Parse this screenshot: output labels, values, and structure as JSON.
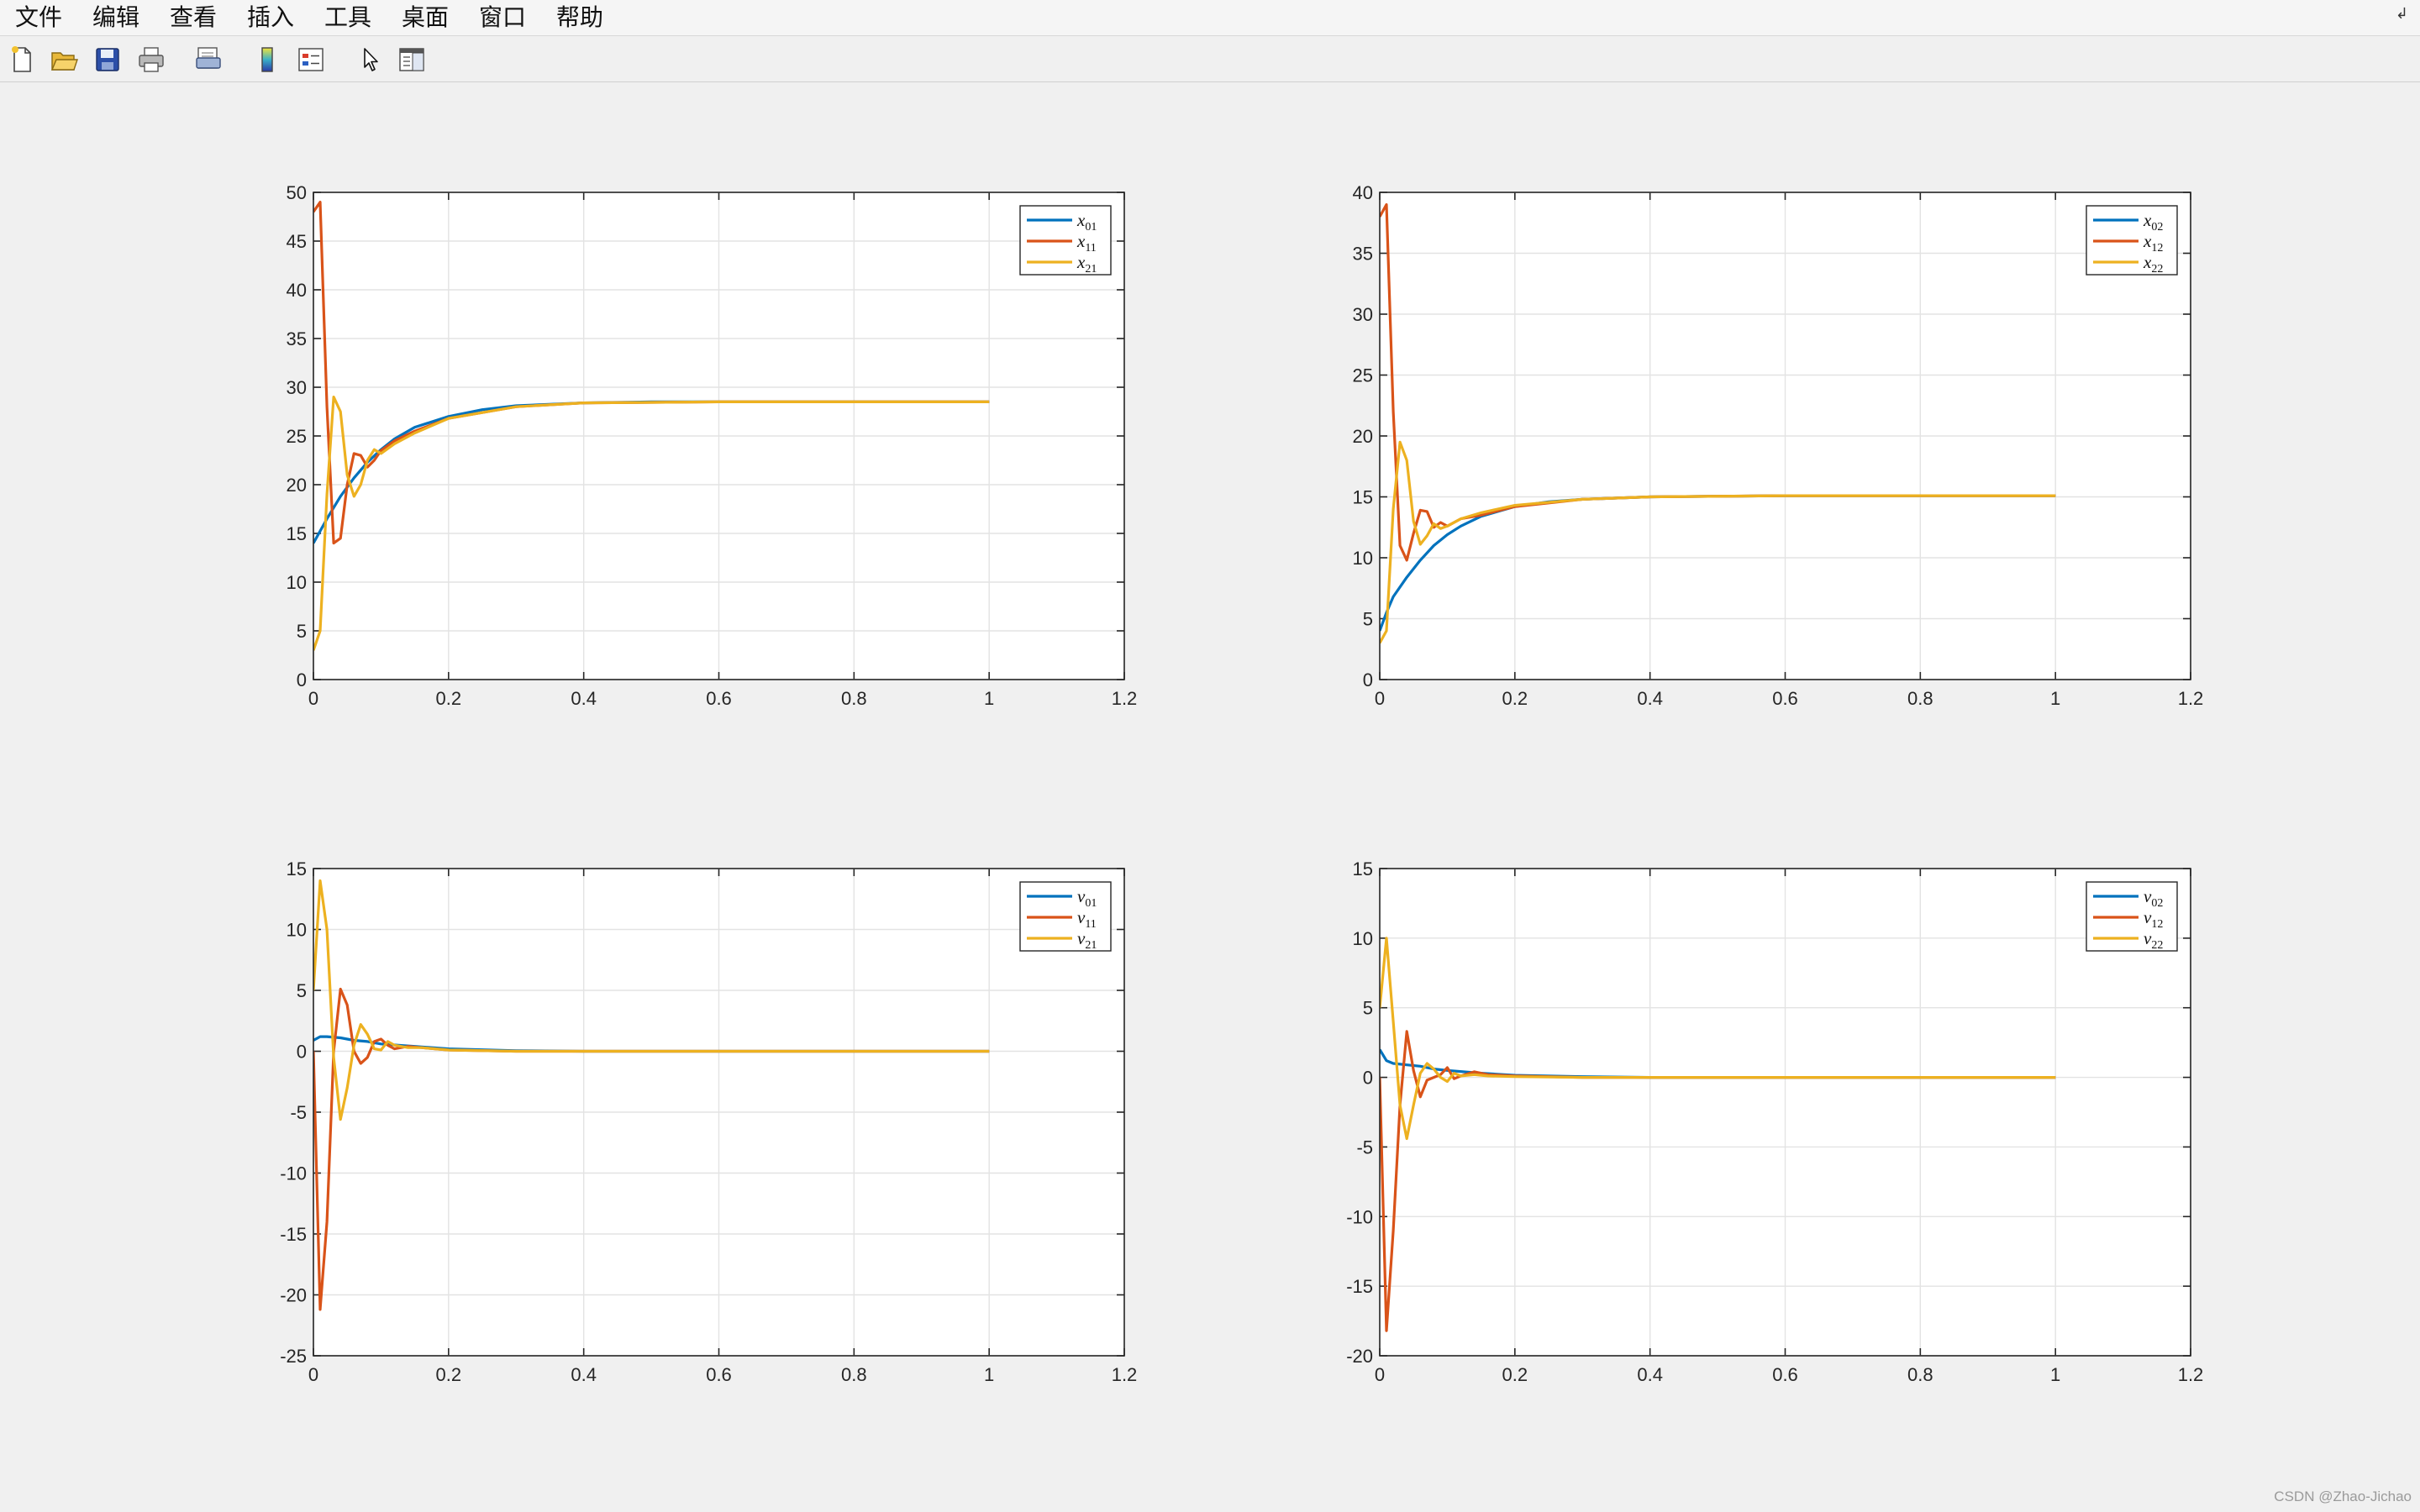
{
  "menu": [
    "文件",
    "编辑",
    "查看",
    "插入",
    "工具",
    "桌面",
    "窗口",
    "帮助"
  ],
  "menu_collapse_glyph": "↲",
  "toolbar": [
    {
      "icon": "new-figure-icon"
    },
    {
      "icon": "open-file-icon"
    },
    {
      "icon": "save-icon"
    },
    {
      "icon": "print-icon"
    },
    {
      "icon": "print-preview-icon"
    },
    {
      "icon": "insert-colorbar-icon"
    },
    {
      "icon": "insert-legend-icon"
    },
    {
      "icon": "edit-plot-icon"
    },
    {
      "icon": "property-inspector-icon"
    }
  ],
  "colors": {
    "series1": "#0072BD",
    "series2": "#D95319",
    "series3": "#EDB120"
  },
  "watermark": "CSDN @Zhao-Jichao",
  "chart_data": [
    {
      "type": "line",
      "xlim": [
        0,
        1.2
      ],
      "ylim": [
        0,
        50
      ],
      "xticks": [
        "0",
        "0.2",
        "0.4",
        "0.6",
        "0.8",
        "1",
        "1.2"
      ],
      "yticks": [
        "0",
        "5",
        "10",
        "15",
        "20",
        "25",
        "30",
        "35",
        "40",
        "45",
        "50"
      ],
      "grid": true,
      "legend_position": "top-right",
      "legend": [
        {
          "base": "x",
          "sub": "01"
        },
        {
          "base": "x",
          "sub": "11"
        },
        {
          "base": "x",
          "sub": "21"
        }
      ],
      "series": [
        {
          "x": [
            0,
            0.02,
            0.04,
            0.06,
            0.08,
            0.1,
            0.12,
            0.15,
            0.2,
            0.25,
            0.3,
            0.4,
            0.5,
            0.6,
            0.8,
            1.0
          ],
          "y": [
            14,
            16.5,
            18.8,
            20.7,
            22.3,
            23.6,
            24.7,
            25.9,
            27,
            27.7,
            28.1,
            28.4,
            28.5,
            28.5,
            28.5,
            28.5
          ]
        },
        {
          "x": [
            0,
            0.01,
            0.02,
            0.03,
            0.04,
            0.05,
            0.06,
            0.07,
            0.08,
            0.09,
            0.1,
            0.12,
            0.15,
            0.2,
            0.3,
            0.4,
            0.6,
            1.0
          ],
          "y": [
            48,
            49,
            28,
            14,
            14.5,
            20,
            23.2,
            23,
            21.8,
            22.5,
            23.5,
            24.5,
            25.5,
            26.8,
            28,
            28.4,
            28.5,
            28.5
          ]
        },
        {
          "x": [
            0,
            0.01,
            0.02,
            0.03,
            0.04,
            0.05,
            0.06,
            0.07,
            0.08,
            0.09,
            0.1,
            0.12,
            0.15,
            0.2,
            0.3,
            0.4,
            0.6,
            1.0
          ],
          "y": [
            3,
            5,
            19,
            29,
            27.5,
            21,
            18.8,
            20,
            22.5,
            23.6,
            23.2,
            24.2,
            25.3,
            26.8,
            28,
            28.4,
            28.5,
            28.5
          ]
        }
      ]
    },
    {
      "type": "line",
      "xlim": [
        0,
        1.2
      ],
      "ylim": [
        0,
        40
      ],
      "xticks": [
        "0",
        "0.2",
        "0.4",
        "0.6",
        "0.8",
        "1",
        "1.2"
      ],
      "yticks": [
        "0",
        "5",
        "10",
        "15",
        "20",
        "25",
        "30",
        "35",
        "40"
      ],
      "grid": true,
      "legend_position": "top-right",
      "legend": [
        {
          "base": "x",
          "sub": "02"
        },
        {
          "base": "x",
          "sub": "12"
        },
        {
          "base": "x",
          "sub": "22"
        }
      ],
      "series": [
        {
          "x": [
            0,
            0.01,
            0.02,
            0.04,
            0.06,
            0.08,
            0.1,
            0.12,
            0.15,
            0.2,
            0.25,
            0.3,
            0.4,
            0.5,
            0.6,
            0.8,
            1.0
          ],
          "y": [
            4,
            5.5,
            6.8,
            8.4,
            9.8,
            11,
            11.9,
            12.6,
            13.4,
            14.2,
            14.6,
            14.8,
            15,
            15.05,
            15.1,
            15.1,
            15.1
          ]
        },
        {
          "x": [
            0,
            0.01,
            0.02,
            0.03,
            0.04,
            0.05,
            0.06,
            0.07,
            0.08,
            0.09,
            0.1,
            0.12,
            0.15,
            0.2,
            0.3,
            0.4,
            0.6,
            1.0
          ],
          "y": [
            38,
            39,
            22,
            11,
            9.8,
            12,
            13.9,
            13.8,
            12.5,
            12.9,
            12.6,
            13.2,
            13.5,
            14.2,
            14.8,
            15,
            15.1,
            15.1
          ]
        },
        {
          "x": [
            0,
            0.01,
            0.02,
            0.03,
            0.04,
            0.05,
            0.06,
            0.07,
            0.08,
            0.09,
            0.1,
            0.12,
            0.15,
            0.2,
            0.3,
            0.4,
            0.6,
            1.0
          ],
          "y": [
            3,
            4,
            14,
            19.5,
            18,
            13,
            11.1,
            11.8,
            12.8,
            12.4,
            12.6,
            13.2,
            13.7,
            14.3,
            14.8,
            15,
            15.1,
            15.1
          ]
        }
      ]
    },
    {
      "type": "line",
      "xlim": [
        0,
        1.2
      ],
      "ylim": [
        -25,
        15
      ],
      "xticks": [
        "0",
        "0.2",
        "0.4",
        "0.6",
        "0.8",
        "1",
        "1.2"
      ],
      "yticks": [
        "-25",
        "-20",
        "-15",
        "-10",
        "-5",
        "0",
        "5",
        "10",
        "15"
      ],
      "grid": true,
      "legend_position": "top-right",
      "legend": [
        {
          "base": "v",
          "sub": "01"
        },
        {
          "base": "v",
          "sub": "11"
        },
        {
          "base": "v",
          "sub": "21"
        }
      ],
      "series": [
        {
          "x": [
            0,
            0.01,
            0.02,
            0.04,
            0.06,
            0.08,
            0.1,
            0.15,
            0.2,
            0.3,
            0.4,
            0.6,
            1.0
          ],
          "y": [
            0.9,
            1.2,
            1.2,
            1.1,
            0.9,
            0.8,
            0.6,
            0.4,
            0.2,
            0.05,
            0,
            0,
            0
          ]
        },
        {
          "x": [
            0,
            0.01,
            0.02,
            0.03,
            0.04,
            0.05,
            0.06,
            0.07,
            0.08,
            0.09,
            0.1,
            0.11,
            0.12,
            0.14,
            0.16,
            0.2,
            0.3,
            0.6,
            1.0
          ],
          "y": [
            0,
            -21.2,
            -14,
            0,
            5.1,
            3.8,
            0,
            -1,
            -0.5,
            0.8,
            1.0,
            0.5,
            0.2,
            0.4,
            0.3,
            0.1,
            0,
            0,
            0
          ]
        },
        {
          "x": [
            0,
            0.01,
            0.02,
            0.03,
            0.04,
            0.05,
            0.06,
            0.07,
            0.08,
            0.09,
            0.1,
            0.11,
            0.12,
            0.14,
            0.16,
            0.2,
            0.3,
            0.6,
            1.0
          ],
          "y": [
            5,
            14,
            10,
            -0.5,
            -5.6,
            -3,
            0.5,
            2.2,
            1.4,
            0.2,
            0.1,
            0.8,
            0.5,
            0.3,
            0.3,
            0.1,
            0,
            0,
            0
          ]
        }
      ]
    },
    {
      "type": "line",
      "xlim": [
        0,
        1.2
      ],
      "ylim": [
        -20,
        15
      ],
      "xticks": [
        "0",
        "0.2",
        "0.4",
        "0.6",
        "0.8",
        "1",
        "1.2"
      ],
      "yticks": [
        "-20",
        "-15",
        "-10",
        "-5",
        "0",
        "5",
        "10",
        "15"
      ],
      "grid": true,
      "legend_position": "top-right",
      "legend": [
        {
          "base": "v",
          "sub": "02"
        },
        {
          "base": "v",
          "sub": "12"
        },
        {
          "base": "v",
          "sub": "22"
        }
      ],
      "series": [
        {
          "x": [
            0,
            0.01,
            0.02,
            0.04,
            0.06,
            0.08,
            0.1,
            0.15,
            0.2,
            0.3,
            0.4,
            0.6,
            1.0
          ],
          "y": [
            2,
            1.2,
            1.0,
            0.9,
            0.8,
            0.6,
            0.5,
            0.3,
            0.15,
            0.05,
            0,
            0,
            0
          ]
        },
        {
          "x": [
            0,
            0.01,
            0.02,
            0.03,
            0.04,
            0.05,
            0.06,
            0.07,
            0.08,
            0.09,
            0.1,
            0.11,
            0.12,
            0.14,
            0.16,
            0.2,
            0.3,
            0.6,
            1.0
          ],
          "y": [
            0,
            -18.2,
            -11,
            -2,
            3.3,
            0.5,
            -1.4,
            -0.2,
            0,
            0.2,
            0.7,
            -0.1,
            0.1,
            0.4,
            0.2,
            0.1,
            0,
            0,
            0
          ]
        },
        {
          "x": [
            0,
            0.01,
            0.02,
            0.03,
            0.04,
            0.05,
            0.06,
            0.07,
            0.08,
            0.09,
            0.1,
            0.11,
            0.12,
            0.14,
            0.16,
            0.2,
            0.3,
            0.6,
            1.0
          ],
          "y": [
            5,
            10,
            4,
            -2,
            -4.4,
            -2,
            0.3,
            1,
            0.6,
            0,
            -0.3,
            0.3,
            0.1,
            0.2,
            0.1,
            0.05,
            0,
            0,
            0
          ]
        }
      ]
    }
  ]
}
